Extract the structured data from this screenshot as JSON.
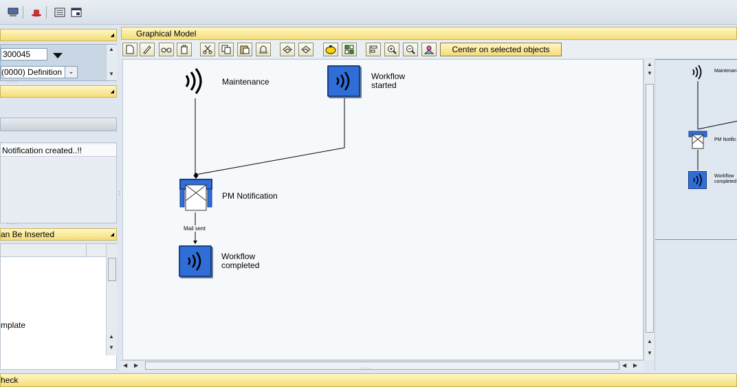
{
  "left_panel": {
    "field_value": "300045",
    "version_value": "(0000) Definition",
    "message_text": "Notification created..!!",
    "steps_header": "an Be Inserted",
    "template_item": "mplate"
  },
  "graphical_model": {
    "title": "Graphical Model",
    "center_button": "Center on selected objects"
  },
  "diagram": {
    "nodes": {
      "maintenance": "Maintenance",
      "workflow_started_1": "Workflow",
      "workflow_started_2": "started",
      "pm_notification": "PM Notification",
      "mail_sent": "Mail sent",
      "workflow_completed_1": "Workflow",
      "workflow_completed_2": "completed"
    }
  },
  "overview": {
    "maintenance": "Maintenan",
    "pm_notif": "PM Notific",
    "wf_completed_1": "Workflow",
    "wf_completed_2": "completed"
  },
  "status_bar": {
    "text": "heck"
  },
  "colors": {
    "yellow": "#f4dd7a",
    "node_blue": "#2f6ed8",
    "canvas": "#f6f9fc",
    "overview_bg": "#dfe8f1",
    "green_line": "#2ecc40"
  }
}
